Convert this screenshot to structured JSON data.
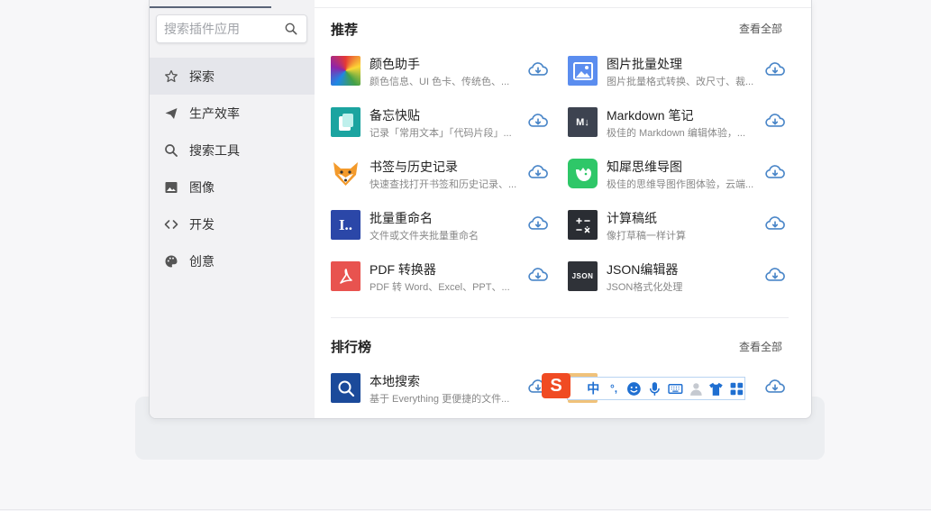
{
  "search": {
    "placeholder": "搜索插件应用"
  },
  "sidebar": {
    "items": [
      {
        "label": "探索",
        "icon": "star-icon",
        "active": true
      },
      {
        "label": "生产效率",
        "icon": "send-icon",
        "active": false
      },
      {
        "label": "搜索工具",
        "icon": "search-icon",
        "active": false
      },
      {
        "label": "图像",
        "icon": "image-icon",
        "active": false
      },
      {
        "label": "开发",
        "icon": "code-icon",
        "active": false
      },
      {
        "label": "创意",
        "icon": "palette-icon",
        "active": false
      }
    ]
  },
  "recommend": {
    "title": "推荐",
    "view_all": "查看全部",
    "apps": [
      {
        "name": "颜色助手",
        "desc": "颜色信息、UI 色卡、传统色、..."
      },
      {
        "name": "图片批量处理",
        "desc": "图片批量格式转换、改尺寸、裁..."
      },
      {
        "name": "备忘快贴",
        "desc": "记录「常用文本」「代码片段」..."
      },
      {
        "name": "Markdown 笔记",
        "desc": "极佳的 Markdown 编辑体验，..."
      },
      {
        "name": "书签与历史记录",
        "desc": "快速查找打开书签和历史记录、..."
      },
      {
        "name": "知犀思维导图",
        "desc": "极佳的思维导图作图体验，云端..."
      },
      {
        "name": "批量重命名",
        "desc": "文件或文件夹批量重命名"
      },
      {
        "name": "计算稿纸",
        "desc": "像打草稿一样计算"
      },
      {
        "name": "PDF 转换器",
        "desc": "PDF 转 Word、Excel、PPT、..."
      },
      {
        "name": "JSON编辑器",
        "desc": "JSON格式化处理"
      }
    ]
  },
  "ranking": {
    "title": "排行榜",
    "view_all": "查看全部",
    "apps": [
      {
        "name": "本地搜索",
        "desc": "基于 Everything 更便捷的文件..."
      }
    ]
  },
  "ime": {
    "logo": "S",
    "mode": "中",
    "punct": "°,"
  },
  "colors": {
    "accent": "#4a86c8",
    "sidebar_bg": "#f2f2f4",
    "active_bg": "#e5e6eb"
  }
}
